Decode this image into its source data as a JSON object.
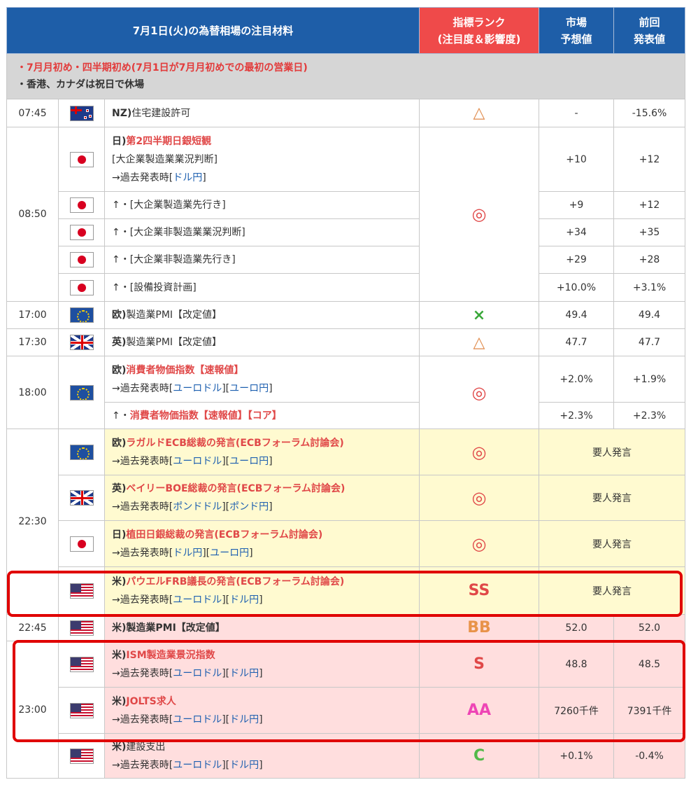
{
  "header": {
    "title": "7月1日(火)の為替相場の注目材料",
    "rank_line1": "指標ランク",
    "rank_line2": "(注目度＆影響度)",
    "forecast_line1": "市場",
    "forecast_line2": "予想値",
    "previous_line1": "前回",
    "previous_line2": "発表値"
  },
  "notice": {
    "line1": "・7月月初め・四半期初め(7月1日が7月月初めでの最初の営業日)",
    "line2": "・香港、カナダは祝日で休場"
  },
  "common": {
    "past": "→過去発表時[",
    "sep": "][",
    "close": "]",
    "usdjpy": "ドル円",
    "eurusd": "ユーロドル",
    "eurjpy": "ユーロ円",
    "gbpusd": "ポンドドル",
    "gbpjpy": "ポンド円",
    "speech": "要人発言",
    "up": "↑・"
  },
  "rows": {
    "nz": {
      "time": "07:45",
      "prefix": "NZ)",
      "name": "住宅建設許可",
      "rank": "△",
      "forecast": "-",
      "previous": "-15.6%"
    },
    "tankan": {
      "time": "08:50",
      "prefix": "日)",
      "name": "第2四半期日銀短観",
      "sub": "[大企業製造業業況判断]",
      "rank": "◎",
      "forecast": "+10",
      "previous": "+12",
      "subs": [
        {
          "name": "[大企業製造業先行き]",
          "forecast": "+9",
          "previous": "+12"
        },
        {
          "name": "[大企業非製造業業況判断]",
          "forecast": "+34",
          "previous": "+35"
        },
        {
          "name": "[大企業非製造業先行き]",
          "forecast": "+29",
          "previous": "+28"
        },
        {
          "name": "[設備投資計画]",
          "forecast": "+10.0%",
          "previous": "+3.1%"
        }
      ]
    },
    "eupmi": {
      "time": "17:00",
      "prefix": "欧)",
      "name": "製造業PMI【改定値】",
      "rank": "×",
      "forecast": "49.4",
      "previous": "49.4"
    },
    "ukpmi": {
      "time": "17:30",
      "prefix": "英)",
      "name": "製造業PMI【改定値】",
      "rank": "△",
      "forecast": "47.7",
      "previous": "47.7"
    },
    "hicp": {
      "time": "18:00",
      "prefix": "欧)",
      "name": "消費者物価指数【速報値】",
      "rank": "◎",
      "forecast": "+2.0%",
      "previous": "+1.9%",
      "core_name": "消費者物価指数【速報値】【コア】",
      "core_forecast": "+2.3%",
      "core_previous": "+2.3%"
    },
    "lagarde": {
      "time": "22:30",
      "prefix": "欧)",
      "name": "ラガルドECB総裁の発言(ECBフォーラム討論会)",
      "rank": "◎"
    },
    "bailey": {
      "prefix": "英)",
      "name": "ベイリーBOE総裁の発言(ECBフォーラム討論会)",
      "rank": "◎"
    },
    "ueda": {
      "prefix": "日)",
      "name": "植田日銀総裁の発言(ECBフォーラム討論会)",
      "rank": "◎"
    },
    "powell": {
      "prefix": "米)",
      "name": "パウエルFRB議長の発言(ECBフォーラム討論会)",
      "rank": "SS"
    },
    "uspmi": {
      "time": "22:45",
      "prefix": "米)",
      "name": "製造業PMI【改定値】",
      "rank": "BB",
      "forecast": "52.0",
      "previous": "52.0"
    },
    "ism": {
      "time": "23:00",
      "prefix": "米)",
      "name": "ISM製造業景況指数",
      "rank": "S",
      "forecast": "48.8",
      "previous": "48.5"
    },
    "jolts": {
      "prefix": "米)",
      "name": "JOLTS求人",
      "rank": "AA",
      "forecast": "7260千件",
      "previous": "7391千件"
    },
    "construction": {
      "prefix": "米)",
      "name": "建設支出",
      "rank": "C",
      "forecast": "+0.1%",
      "previous": "-0.4%"
    }
  },
  "colors": {
    "header_blue": "#1e5ea8",
    "rank_red": "#ef4a4a",
    "highlight_red": "#e04848",
    "link_blue": "#1e60b0",
    "speech_yellow": "#fffad0",
    "us_pink": "#ffdede",
    "box_red": "#e00000"
  }
}
